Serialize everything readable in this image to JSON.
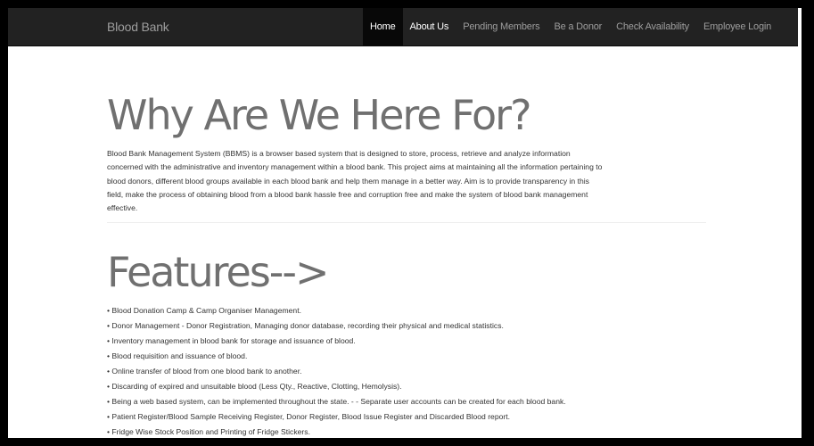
{
  "navbar": {
    "brand": "Blood Bank",
    "items": [
      {
        "label": "Home"
      },
      {
        "label": "About Us"
      },
      {
        "label": "Pending Members"
      },
      {
        "label": "Be a Donor"
      },
      {
        "label": "Check Availability"
      },
      {
        "label": "Employee Login"
      }
    ]
  },
  "main": {
    "heading_why": "Why Are We Here For?",
    "intro": "Blood Bank Management System (BBMS) is a browser based system that is designed to store, process, retrieve and analyze information concerned with the administrative and inventory management within a blood bank. This project aims at maintaining all the information pertaining to blood donors, different blood groups available in each blood bank and help them manage in a better way. Aim is to provide transparency in this field, make the process of obtaining blood from a blood bank hassle free and corruption free and make the system of blood bank management effective.",
    "heading_features": "Features-->",
    "features": [
      "Blood Donation Camp & Camp Organiser Management.",
      "Donor Management - Donor Registration, Managing donor database, recording their physical and medical statistics.",
      "Inventory management in blood bank for storage and issuance of blood.",
      "Blood requisition and issuance of blood.",
      "Online transfer of blood from one blood bank to another.",
      "Discarding of expired and unsuitable blood (Less Qty., Reactive, Clotting, Hemolysis).",
      "Being a web based system, can be implemented throughout the state. - - Separate user accounts can be created for each blood bank.",
      "Patient Register/Blood Sample Receiving Register, Donor Register, Blood Issue Register and Discarded Blood report.",
      "Fridge Wise Stock Position and Printing of Fridge Stickers."
    ]
  },
  "colors": {
    "navbar_bg": "#222222",
    "nav_text": "#9d9d9d",
    "nav_active_bg": "#080808",
    "heading": "#707070",
    "body_text": "#333333"
  }
}
